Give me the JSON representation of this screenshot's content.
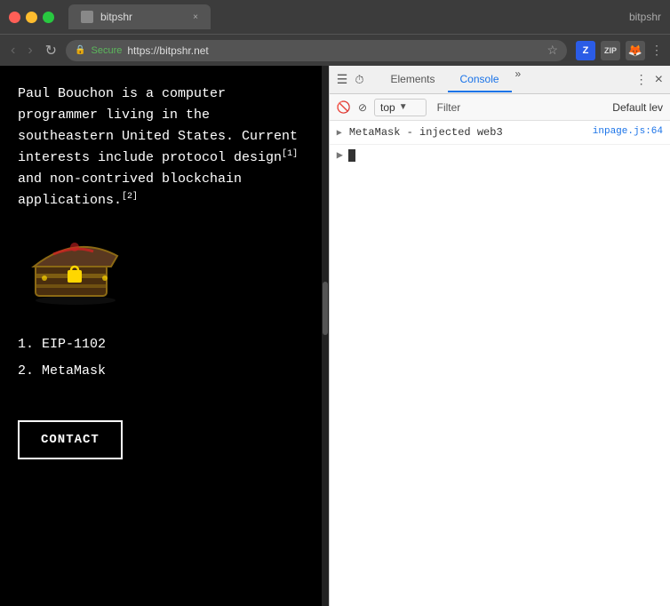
{
  "browser": {
    "title": "bitpshr",
    "tab_label": "bitpshr",
    "tab_close": "×",
    "nav_back": "‹",
    "nav_forward": "›",
    "nav_refresh": "↻",
    "secure_label": "Secure",
    "url": "https://bitpshr.net",
    "star": "☆",
    "top_right_icon": "bitpshr",
    "ext_z": "Z",
    "ext_zip": "ZIP",
    "menu_dots": "⋮"
  },
  "website": {
    "bio_text_1": "Paul Bouchon is a computer programmer living in the southeastern United States. Current interests include protocol design",
    "footnote1": "[1]",
    "bio_text_2": " and non-contrived blockchain applications.",
    "footnote2": "[2]",
    "references": [
      {
        "num": "1.",
        "label": "EIP-1102"
      },
      {
        "num": "2.",
        "label": "MetaMask"
      }
    ],
    "contact_button": "CONTACT"
  },
  "devtools": {
    "elements_tab": "Elements",
    "console_tab": "Console",
    "more": "»",
    "more2": "⋮",
    "close": "×",
    "top_context": "top",
    "filter_placeholder": "Filter",
    "default_levels": "Default lev",
    "console_messages": [
      {
        "text": "MetaMask - injected web3",
        "file": "inpage.js:64"
      }
    ]
  }
}
